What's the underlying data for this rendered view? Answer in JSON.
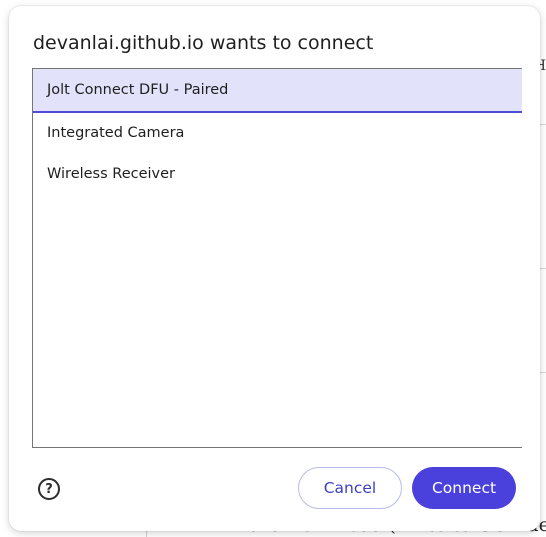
{
  "dialog": {
    "title": "devanlai.github.io wants to connect",
    "devices": [
      {
        "label": "Jolt Connect DFU - Paired",
        "selected": true
      },
      {
        "label": "Integrated Camera",
        "selected": false
      },
      {
        "label": "Wireless Receiver",
        "selected": false
      }
    ],
    "help_icon": "help-circle-icon",
    "help_glyph": "?",
    "cancel_label": "Cancel",
    "connect_label": "Connect"
  },
  "background_page": {
    "heading_fragment": "Firmware Download (write to USB devi",
    "edge_glyph": "H"
  },
  "colors": {
    "accent": "#4a41dc",
    "selected_row": "#e2e3fb",
    "cancel_text": "#3f3fc5"
  }
}
